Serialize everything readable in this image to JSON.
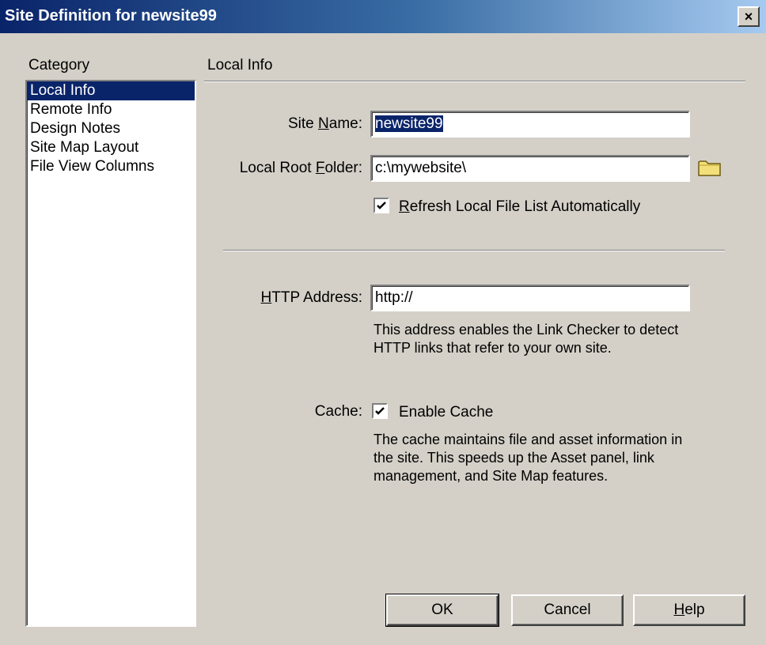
{
  "window": {
    "title": "Site Definition for newsite99",
    "close_label": "×"
  },
  "category": {
    "label": "Category",
    "items": [
      {
        "label": "Local Info",
        "selected": true
      },
      {
        "label": "Remote Info",
        "selected": false
      },
      {
        "label": "Design Notes",
        "selected": false
      },
      {
        "label": "Site Map Layout",
        "selected": false
      },
      {
        "label": "File View Columns",
        "selected": false
      }
    ]
  },
  "section": {
    "title": "Local Info"
  },
  "site_name": {
    "label_pre": "Site ",
    "label_ul": "N",
    "label_post": "ame:",
    "value": "newsite99"
  },
  "local_root": {
    "label_pre": "Local Root ",
    "label_ul": "F",
    "label_post": "older:",
    "value": "c:\\mywebsite\\",
    "icon": "folder-icon"
  },
  "refresh": {
    "checked": true,
    "label_ul": "R",
    "label_post": "efresh Local File List Automatically"
  },
  "http": {
    "label_ul": "H",
    "label_post": "TTP Address:",
    "value": "http://",
    "help": "This address enables the Link Checker to detect HTTP links that refer to your own site."
  },
  "cache": {
    "label": "Cache:",
    "checked": true,
    "check_label": "Enable Cache",
    "help": "The cache maintains file and asset information in the site.  This speeds up the Asset panel, link management, and Site Map features."
  },
  "buttons": {
    "ok": "OK",
    "cancel": "Cancel",
    "help_ul": "H",
    "help_post": "elp"
  },
  "colors": {
    "dialog_bg": "#d4d0c8",
    "title_bar_start": "#0a246a",
    "title_bar_end": "#a6caf0",
    "selection": "#0a246a",
    "folder": "#f4e07a"
  }
}
